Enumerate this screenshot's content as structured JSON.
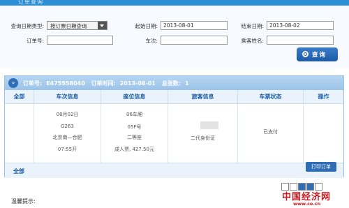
{
  "page": {
    "title": "订单查询"
  },
  "query": {
    "date_type_label": "查询日期类型:",
    "date_type_value": "按订票日期查询",
    "start_label": "起始日期:",
    "start_value": "2013-08-01",
    "end_label": "结束日期:",
    "end_value": "2013-08-02",
    "order_no_label": "订单号:",
    "train_no_label": "车次:",
    "passenger_label": "乘客姓名:",
    "search_label": "查询"
  },
  "order": {
    "order_no_label": "订单号:",
    "order_no": "E475558040",
    "order_time_label": "订单时间:",
    "order_time": "2013-08-01",
    "total_label": "总张数:",
    "total": "1",
    "columns": [
      "全部",
      "车次信息",
      "座位信息",
      "旅客信息",
      "车票状态",
      "操作"
    ],
    "row": {
      "date": "08月02日",
      "train": "G263",
      "route": "北京南—合肥",
      "depart": "07:55开",
      "car": "06车厢",
      "seat": "05F号",
      "class": "二等座",
      "fare": "成人票, 427.50元",
      "id_type": "二代身份证",
      "status": "已支付"
    },
    "footer_all": "全部",
    "print_label": "打印订单"
  },
  "tips": {
    "label": "温馨提示:"
  },
  "watermark": {
    "name": "中国经济网",
    "url": "www.ce.cn"
  }
}
